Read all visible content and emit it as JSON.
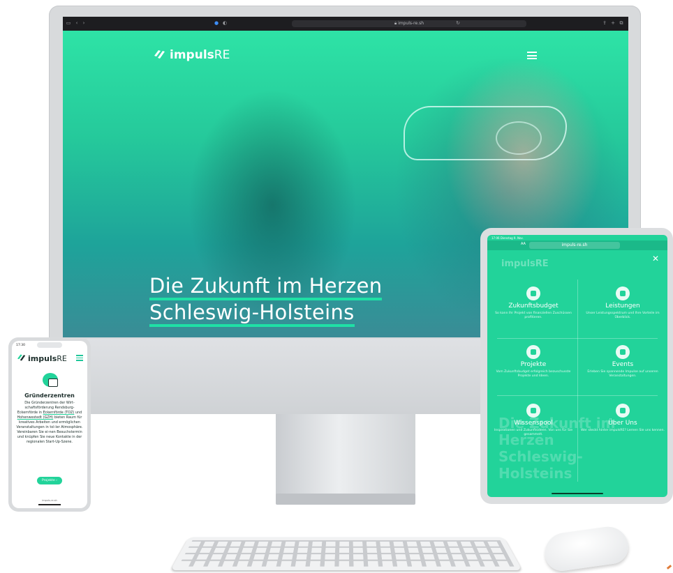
{
  "desktop": {
    "browser": {
      "url": "impuls-re.sh"
    },
    "hero": {
      "logo": {
        "bold": "impuls",
        "thin": "RE"
      },
      "headline_line1": "Die Zukunft im Herzen",
      "headline_line2": "Schleswig-Holsteins"
    }
  },
  "tablet": {
    "status": "17:06 Dienstag 9. Nov.",
    "url": "impuls-re.sh",
    "aa_label": "AA",
    "faint_logo": "impulsRE",
    "menu_items": [
      {
        "title": "Zukunftsbudget",
        "desc": "So kann Ihr Projekt von finanziellen Zuschüssen profitieren.",
        "icon": "rocket-icon"
      },
      {
        "title": "Leistungen",
        "desc": "Unser Leistungsspektrum und Ihre Vorteile im Überblick.",
        "icon": "mountain-flag-icon"
      },
      {
        "title": "Projekte",
        "desc": "Vom Zukunftsbudget erfolgreich bezuschusste Projekte und Ideen.",
        "icon": "desk-lamp-icon"
      },
      {
        "title": "Events",
        "desc": "Erleben Sie spannende Impulse auf unseren Veranstaltungen.",
        "icon": "presentation-icon"
      },
      {
        "title": "Wissenspool",
        "desc": "Inspirationen und Zukunftsideen. Von uns für Sie gesammelt.",
        "icon": "globe-icon"
      },
      {
        "title": "Über Uns",
        "desc": "Wer steckt hinter impulsRE? Lernen Sie uns kennen.",
        "icon": "people-icon"
      }
    ],
    "background_headline": [
      "Die Zukunft im",
      "Herzen",
      "Schleswig-",
      "Holsteins"
    ]
  },
  "phone": {
    "status_time": "17:30",
    "logo": {
      "bold": "impuls",
      "thin": "RE"
    },
    "section_title": "Gründerzentren",
    "body_before_link1": "Die Gründerzentren der Wirt-schaftsförderung Rendsburg-Eckernförde in ",
    "link1": "Eckernförde (TOZ)",
    "body_between": " und ",
    "link2": "Hohenwestedt (GZH)",
    "body_after": " bieten Raum für kreatives Arbeiten und ermöglichen Veranstaltungen in tol-ler Atmosphäre. Vereinbaren Sie ei-nen Besuchstermin und knüpfen Sie neue Kontakte in der regionalen Start-Up-Szene.",
    "button_label": "Projekte ›",
    "url": "impuls-re.sh"
  },
  "colors": {
    "brand_green": "#22d39a",
    "dark_text": "#1b2d2a"
  }
}
